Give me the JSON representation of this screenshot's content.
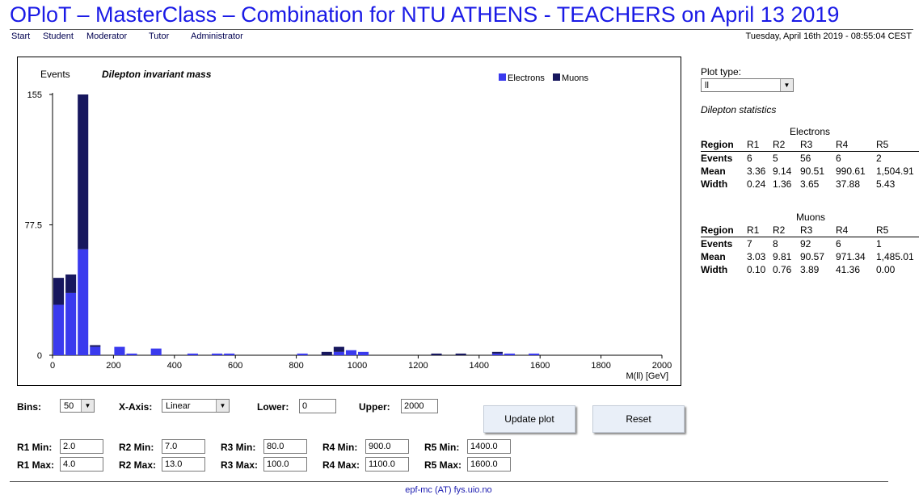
{
  "page": {
    "title": "OPloT – MasterClass – Combination for NTU ATHENS - TEACHERS on April 13 2019",
    "datetime": "Tuesday, April 16th 2019 - 08:55:04 CEST",
    "footer": "epf-mc (AT) fys.uio.no"
  },
  "nav": {
    "items": [
      "Start",
      "Student",
      "Moderator",
      "Tutor",
      "Administrator"
    ]
  },
  "plot_type": {
    "label": "Plot type:",
    "value": "ll"
  },
  "stats": {
    "title": "Dilepton statistics",
    "electrons": {
      "caption": "Electrons",
      "header": [
        "Region",
        "R1",
        "R2",
        "R3",
        "R4",
        "R5"
      ],
      "rows": [
        [
          "Events",
          "6",
          "5",
          "56",
          "6",
          "2"
        ],
        [
          "Mean",
          "3.36",
          "9.14",
          "90.51",
          "990.61",
          "1,504.91"
        ],
        [
          "Width",
          "0.24",
          "1.36",
          "3.65",
          "37.88",
          "5.43"
        ]
      ]
    },
    "muons": {
      "caption": "Muons",
      "header": [
        "Region",
        "R1",
        "R2",
        "R3",
        "R4",
        "R5"
      ],
      "rows": [
        [
          "Events",
          "7",
          "8",
          "92",
          "6",
          "1"
        ],
        [
          "Mean",
          "3.03",
          "9.81",
          "90.57",
          "971.34",
          "1,485.01"
        ],
        [
          "Width",
          "0.10",
          "0.76",
          "3.89",
          "41.36",
          "0.00"
        ]
      ]
    }
  },
  "controls": {
    "bins_label": "Bins:",
    "bins_value": "50",
    "xaxis_label": "X-Axis:",
    "xaxis_value": "Linear",
    "lower_label": "Lower:",
    "lower_value": "0",
    "upper_label": "Upper:",
    "upper_value": "2000",
    "update_button": "Update plot",
    "reset_button": "Reset",
    "regions": [
      {
        "min_label": "R1 Min:",
        "min": "2.0",
        "max_label": "R1 Max:",
        "max": "4.0"
      },
      {
        "min_label": "R2 Min:",
        "min": "7.0",
        "max_label": "R2 Max:",
        "max": "13.0"
      },
      {
        "min_label": "R3 Min:",
        "min": "80.0",
        "max_label": "R3 Max:",
        "max": "100.0"
      },
      {
        "min_label": "R4 Min:",
        "min": "900.0",
        "max_label": "R4 Max:",
        "max": "1100.0"
      },
      {
        "min_label": "R5 Min:",
        "min": "1400.0",
        "max_label": "R5 Max:",
        "max": "1600.0"
      }
    ]
  },
  "colors": {
    "electrons": "#3a3aee",
    "muons": "#17175e",
    "title": "#1a1ae6"
  },
  "chart_data": {
    "type": "bar",
    "stacked": true,
    "title": "Dilepton invariant mass",
    "ylabel": "Events",
    "xlabel": "M(ll) [GeV]",
    "xlim": [
      0,
      2000
    ],
    "ylim": [
      0,
      155
    ],
    "yticks": [
      "0",
      "77.5",
      "155"
    ],
    "xticks": [
      "0",
      "200",
      "400",
      "600",
      "800",
      "1000",
      "1200",
      "1400",
      "1600",
      "1800",
      "2000"
    ],
    "bin_width": 40,
    "legend": [
      "Electrons",
      "Muons"
    ],
    "legend_position": "top-right",
    "series": [
      {
        "name": "Electrons",
        "bins": [
          [
            0,
            30
          ],
          [
            40,
            37
          ],
          [
            80,
            63
          ],
          [
            120,
            5
          ],
          [
            200,
            5
          ],
          [
            240,
            1
          ],
          [
            320,
            4
          ],
          [
            440,
            1
          ],
          [
            520,
            1
          ],
          [
            560,
            1
          ],
          [
            800,
            1
          ],
          [
            920,
            2
          ],
          [
            960,
            3
          ],
          [
            1000,
            2
          ],
          [
            1440,
            1
          ],
          [
            1480,
            1
          ],
          [
            1560,
            1
          ]
        ]
      },
      {
        "name": "Muons",
        "bins": [
          [
            0,
            16
          ],
          [
            40,
            11
          ],
          [
            80,
            92
          ],
          [
            120,
            1
          ],
          [
            880,
            2
          ],
          [
            920,
            3
          ],
          [
            1240,
            1
          ],
          [
            1320,
            1
          ],
          [
            1440,
            1
          ]
        ]
      }
    ]
  }
}
